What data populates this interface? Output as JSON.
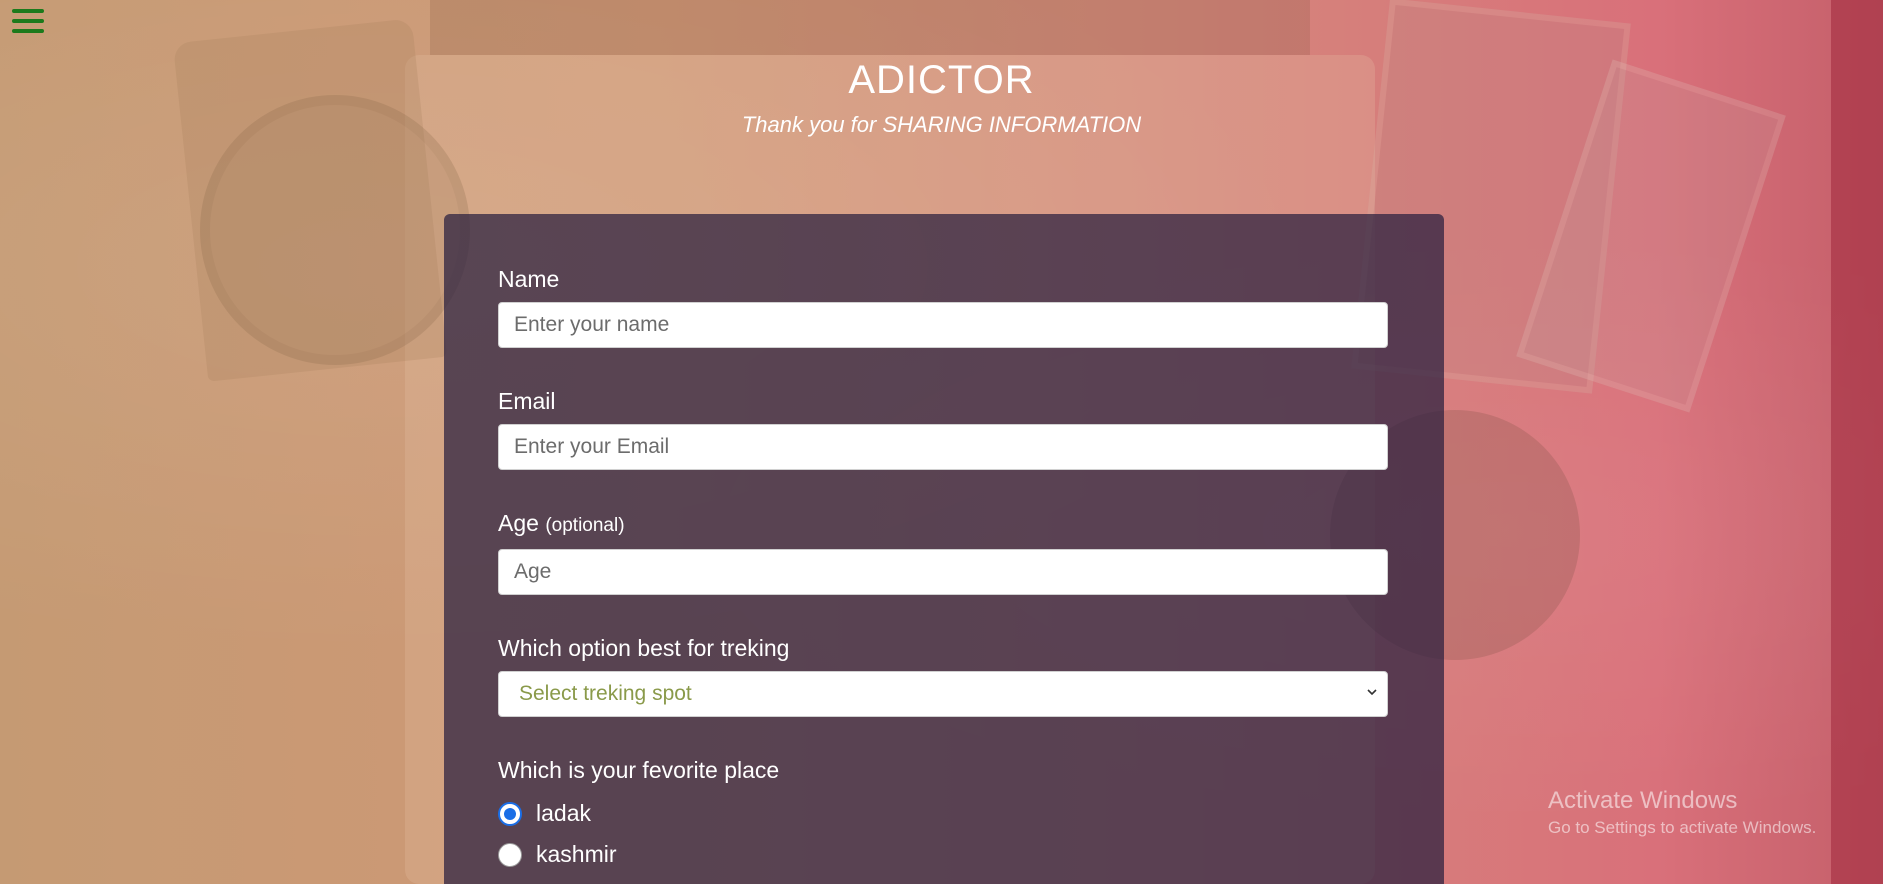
{
  "header": {
    "title": "ADICTOR",
    "subtitle": "Thank you for SHARING INFORMATION"
  },
  "menu": {
    "icon": "hamburger-menu-icon",
    "color": "#1c7a1c"
  },
  "form": {
    "name": {
      "label": "Name",
      "placeholder": "Enter your name"
    },
    "email": {
      "label": "Email",
      "placeholder": "Enter your Email"
    },
    "age": {
      "label": "Age",
      "optional_note": "(optional)",
      "placeholder": "Age"
    },
    "trekking": {
      "label": "Which option best for treking",
      "selected": "Select treking spot"
    },
    "favorite_place": {
      "label": "Which is your fevorite place",
      "options": [
        {
          "label": "ladak",
          "checked": true
        },
        {
          "label": "kashmir",
          "checked": false
        }
      ]
    }
  },
  "watermark": {
    "title": "Activate Windows",
    "subtitle": "Go to Settings to activate Windows."
  },
  "colors": {
    "panel": "#281e3e",
    "accent_radio": "#1a6ee6",
    "select_text": "#8a9a4a"
  }
}
